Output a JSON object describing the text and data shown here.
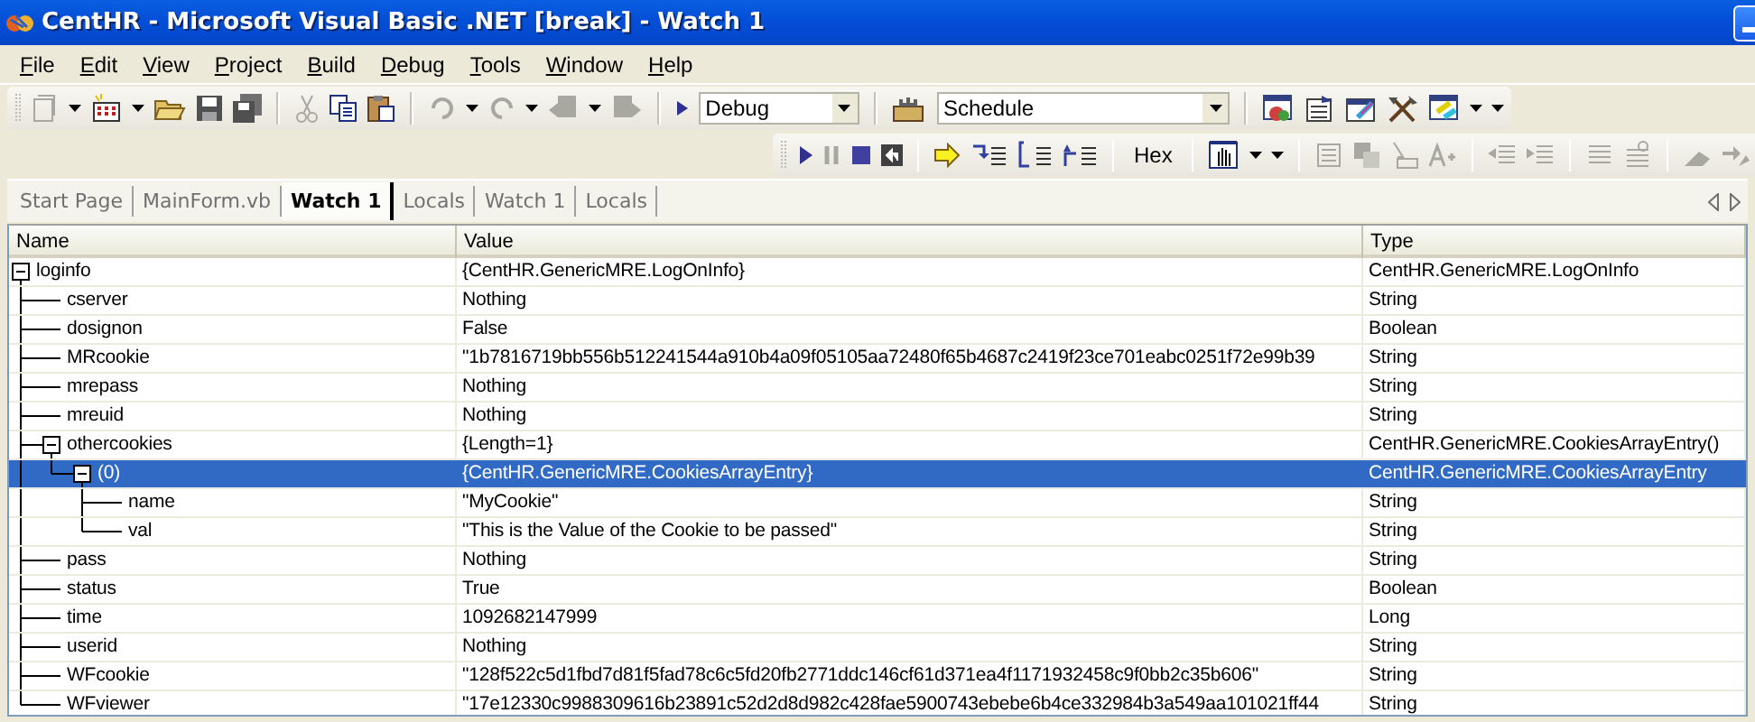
{
  "window": {
    "title": "CentHR - Microsoft Visual Basic .NET [break] - Watch 1"
  },
  "menu": [
    "File",
    "Edit",
    "View",
    "Project",
    "Build",
    "Debug",
    "Tools",
    "Window",
    "Help"
  ],
  "toolbar_standard": {
    "configuration": "Debug",
    "project": "Schedule"
  },
  "toolbar_debug": {
    "hex_button": "Hex"
  },
  "tabs": [
    {
      "label": "Start Page",
      "selected": false
    },
    {
      "label": "MainForm.vb",
      "selected": false
    },
    {
      "label": "Watch 1",
      "selected": true
    },
    {
      "label": "Locals",
      "selected": false
    },
    {
      "label": "Watch 1",
      "selected": false
    },
    {
      "label": "Locals",
      "selected": false
    }
  ],
  "watch": {
    "columns": [
      "Name",
      "Value",
      "Type"
    ],
    "rows": [
      {
        "name": "loginfo",
        "value": "{CentHR.GenericMRE.LogOnInfo}",
        "type": "CentHR.GenericMRE.LogOnInfo",
        "expanded": true,
        "selected": false,
        "children": [
          {
            "name": "cserver",
            "value": "Nothing",
            "type": "String",
            "selected": false
          },
          {
            "name": "dosignon",
            "value": "False",
            "type": "Boolean",
            "selected": false
          },
          {
            "name": "MRcookie",
            "value": "\"1b7816719bb556b512241544a910b4a09f05105aa72480f65b4687c2419f23ce701eabc0251f72e99b39",
            "type": "String",
            "selected": false
          },
          {
            "name": "mrepass",
            "value": "Nothing",
            "type": "String",
            "selected": false
          },
          {
            "name": "mreuid",
            "value": "Nothing",
            "type": "String",
            "selected": false
          },
          {
            "name": "othercookies",
            "value": "{Length=1}",
            "type": "CentHR.GenericMRE.CookiesArrayEntry()",
            "expanded": true,
            "selected": false,
            "children": [
              {
                "name": "(0)",
                "value": "{CentHR.GenericMRE.CookiesArrayEntry}",
                "type": "CentHR.GenericMRE.CookiesArrayEntry",
                "expanded": true,
                "selected": true,
                "children": [
                  {
                    "name": "name",
                    "value": "\"MyCookie\"",
                    "type": "String",
                    "selected": false
                  },
                  {
                    "name": "val",
                    "value": "\"This is the Value of the Cookie to be passed\"",
                    "type": "String",
                    "selected": false
                  }
                ]
              }
            ]
          },
          {
            "name": "pass",
            "value": "Nothing",
            "type": "String",
            "selected": false
          },
          {
            "name": "status",
            "value": "True",
            "type": "Boolean",
            "selected": false
          },
          {
            "name": "time",
            "value": "1092682147999",
            "type": "Long",
            "selected": false
          },
          {
            "name": "userid",
            "value": "Nothing",
            "type": "String",
            "selected": false
          },
          {
            "name": "WFcookie",
            "value": "\"128f522c5d1fbd7d81f5fad78c6c5fd20fb2771ddc146cf61d371ea4f1171932458c9f0bb2c35b606\"",
            "type": "String",
            "selected": false
          },
          {
            "name": "WFviewer",
            "value": "\"17e12330c9988309616b23891c52d2d8d982c428fae5900743ebebe6b4ce332984b3a549aa101021ff44",
            "type": "String",
            "selected": false
          }
        ]
      }
    ]
  }
}
